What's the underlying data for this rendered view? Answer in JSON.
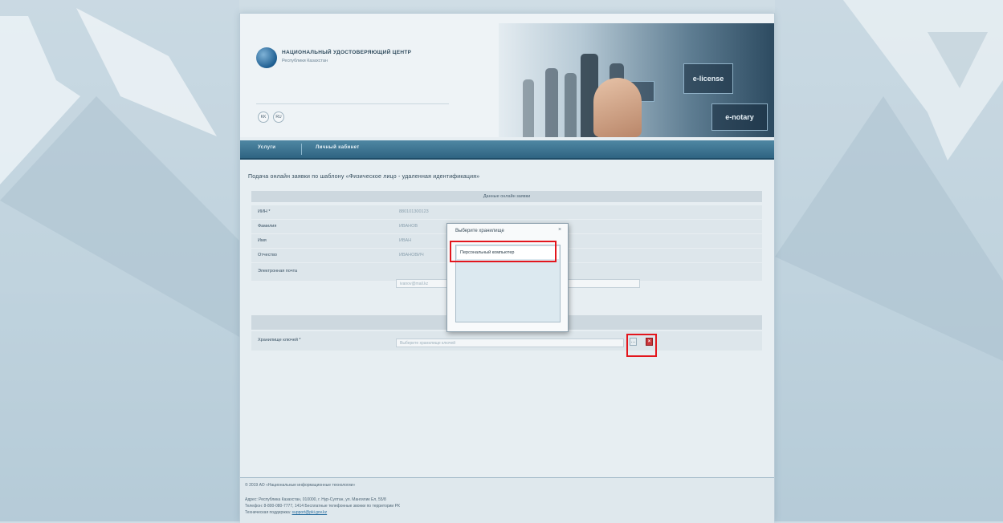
{
  "logo": {
    "title": "НАЦИОНАЛЬНЫЙ УДОСТОВЕРЯЮЩИЙ ЦЕНТР",
    "subtitle": "Республики Казахстан"
  },
  "languages": [
    "KK",
    "RU"
  ],
  "banner": {
    "screen_labels": [
      "e-license",
      "e-notary"
    ]
  },
  "nav": {
    "items": [
      "Услуги",
      "Личный кабинет"
    ]
  },
  "form": {
    "title": "Подача онлайн заявки по шаблону «Физическое лицо - удаленная идентификация»",
    "section1_title": "Данные онлайн заявки",
    "rows": [
      {
        "label": "ИИН *",
        "value": "880101300123"
      },
      {
        "label": "Фамилия",
        "value": "ИВАНОВ"
      },
      {
        "label": "Имя",
        "value": "ИВАН"
      },
      {
        "label": "Отчество",
        "value": "ИВАНОВИЧ"
      }
    ],
    "email_label": "Электронная почта",
    "email_value": "ivanov@mail.kz",
    "storage_label": "Хранилище ключей *",
    "storage_placeholder": "Выберите хранилище ключей"
  },
  "dialog": {
    "title": "Выберите хранилище",
    "close": "×",
    "option": "Персональный компьютер"
  },
  "footer": {
    "copyright": "© 2019 АО «Национальные информационные технологии»",
    "address": "Адрес: Республика Казахстан, 010000, г. Нур-Султан, ул. Мангилик Ел, 55/8",
    "phone": "Телефон: 8-800-080-7777, 1414 Бесплатные телефонные звонки по территории РК",
    "support_label": "Техническая поддержка:",
    "support_link": "support@pki.gov.kz"
  }
}
